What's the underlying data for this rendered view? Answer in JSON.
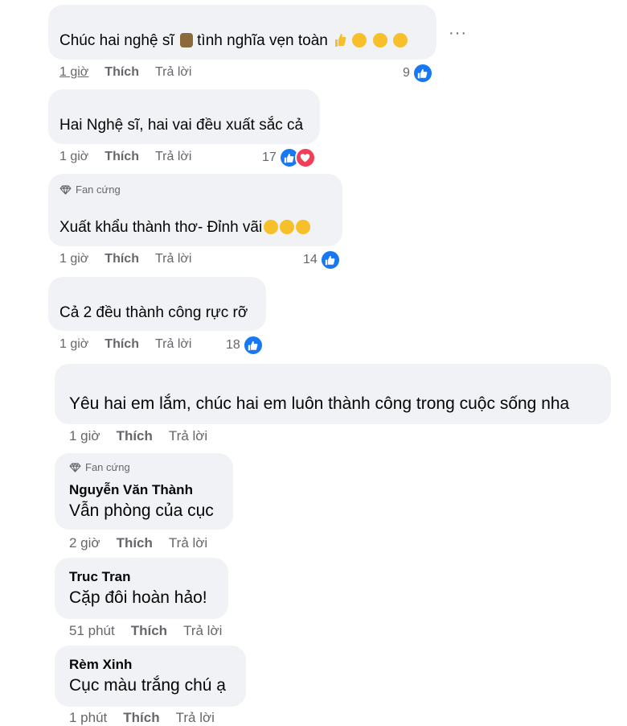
{
  "more_menu": "···",
  "comments": [
    {
      "text": "Chúc hai nghệ sĩ",
      "text_after": "tình nghĩa vẹn toàn",
      "time": "1 giờ",
      "like": "Thích",
      "reply": "Trả lời",
      "reactions": "9"
    },
    {
      "text": "Hai Nghệ sĩ, hai vai đều xuất sắc cả",
      "time": "1 giờ",
      "like": "Thích",
      "reply": "Trả lời",
      "reactions": "17"
    },
    {
      "badge": "Fan cứng",
      "text": "Xuất khẩu thành thơ- Đỉnh vãi",
      "time": "1 giờ",
      "like": "Thích",
      "reply": "Trả lời",
      "reactions": "14"
    },
    {
      "text": "Cả 2 đều thành công rực rỡ",
      "time": "1 giờ",
      "like": "Thích",
      "reply": "Trả lời",
      "reactions": "18"
    },
    {
      "text": "Yêu hai em lắm, chúc hai em luôn thành công trong cuộc sống nha",
      "time": "1 giờ",
      "like": "Thích",
      "reply": "Trả lời"
    },
    {
      "badge": "Fan cứng",
      "name": "Nguyễn Văn Thành",
      "text": "Vẫn phòng của cục",
      "time": "2 giờ",
      "like": "Thích",
      "reply": "Trả lời"
    },
    {
      "name": "Truc Tran",
      "text": "Cặp đôi hoàn hảo!",
      "time": "51 phút",
      "like": "Thích",
      "reply": "Trả lời"
    },
    {
      "name": "Rèm Xinh",
      "text": "Cục màu trắng chú ạ",
      "time": "1 phút",
      "like": "Thích",
      "reply": "Trả lời"
    }
  ],
  "icons": {
    "like": "like-reaction-icon",
    "heart": "love-reaction-icon",
    "diamond": "diamond-icon"
  },
  "colors": {
    "bubble": "#f0f2f5",
    "meta": "#65676b",
    "like_blue": "#1877f2",
    "love_red": "#f33e58"
  }
}
